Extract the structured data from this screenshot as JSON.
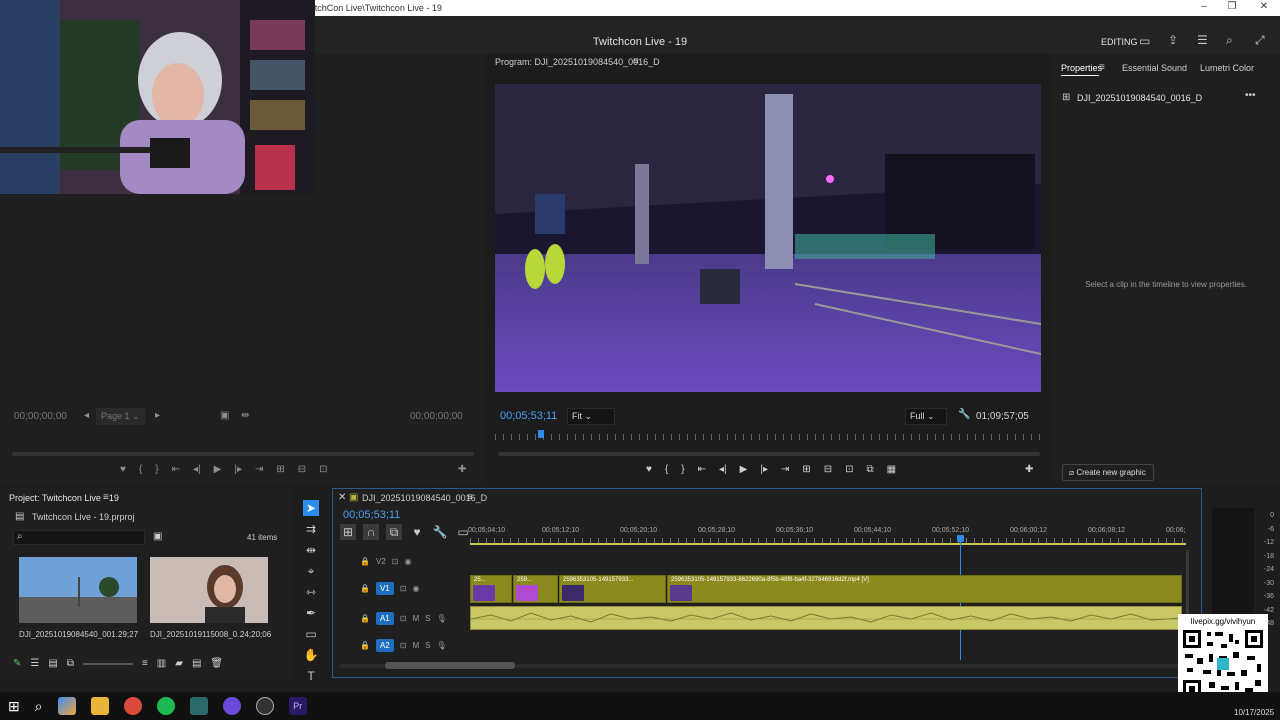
{
  "window": {
    "title": "Adobe Premiere Pro 2025 - V:\\ TIKTOK\\Twitch Con\\Dia 19 DOMINGO - TwitchCon Live\\Twitchcon Live - 19",
    "minimize": "–",
    "maximize": "❐",
    "close": "✕"
  },
  "header": {
    "project_title": "Twitchcon Live - 19",
    "workspace": "EDITING"
  },
  "source_monitor": {
    "timecode_in": "00;00;00;00",
    "page": "Page 1",
    "timecode_out": "00;00;00;00"
  },
  "program": {
    "title": "Program: DJI_20251019084540_0016_D",
    "timecode": "00;05;53;11",
    "fit": "Fit",
    "quality": "Full",
    "duration": "01;09;57;05"
  },
  "properties": {
    "tabs": [
      "Properties",
      "Essential Sound",
      "Lumetri Color"
    ],
    "clip_name": "DJI_20251019084540_0016_D",
    "hint": "Select a clip in the timeline to view properties.",
    "create_graphic": "Create new graphic"
  },
  "project": {
    "title": "Project: Twitchcon Live - 19",
    "file": "Twitchcon Live - 19.prproj",
    "count": "41 items",
    "search_placeholder": "",
    "items": [
      {
        "name": "DJI_20251019084540_001...",
        "duration": "29;27"
      },
      {
        "name": "DJI_20251019115008_0...",
        "duration": "24;20;06"
      }
    ]
  },
  "timeline": {
    "sequence": "DJI_20251019084540_0016_D",
    "timecode": "00;05;53;11",
    "ruler": [
      "00;05;04;10",
      "00;05;12;10",
      "00;05;20;10",
      "00;05;28;10",
      "00;05;36;10",
      "00;05;44;10",
      "00;05;52;10",
      "00;06;00;12",
      "00;06;08;12",
      "00;06;"
    ],
    "tracks": [
      {
        "id": "V2",
        "type": "video"
      },
      {
        "id": "V1",
        "type": "video",
        "target": true
      },
      {
        "id": "A1",
        "type": "audio",
        "target": true
      },
      {
        "id": "A2",
        "type": "audio",
        "target": true
      }
    ],
    "track_m": "M",
    "track_s": "S",
    "v1_clips": [
      "25...",
      "259...",
      "2596353105-149157933...",
      "2596353105-149157933-8622690a-8f5b-48f8-ba4f-327846916d2f.mp4 [V]"
    ]
  },
  "meter": {
    "scale": [
      "0",
      "-6",
      "-12",
      "-18",
      "-24",
      "-30",
      "-36",
      "-42",
      "-48"
    ]
  },
  "overlay": {
    "qr_caption": "livepix.gg/vivihyun"
  },
  "taskbar": {
    "date": "10/17/2025"
  },
  "colors": {
    "accent": "#2d8ceb",
    "clip_video": "#8a8a1e",
    "clip_audio": "#c9c864",
    "purple_scene": "#5a3fa8"
  }
}
